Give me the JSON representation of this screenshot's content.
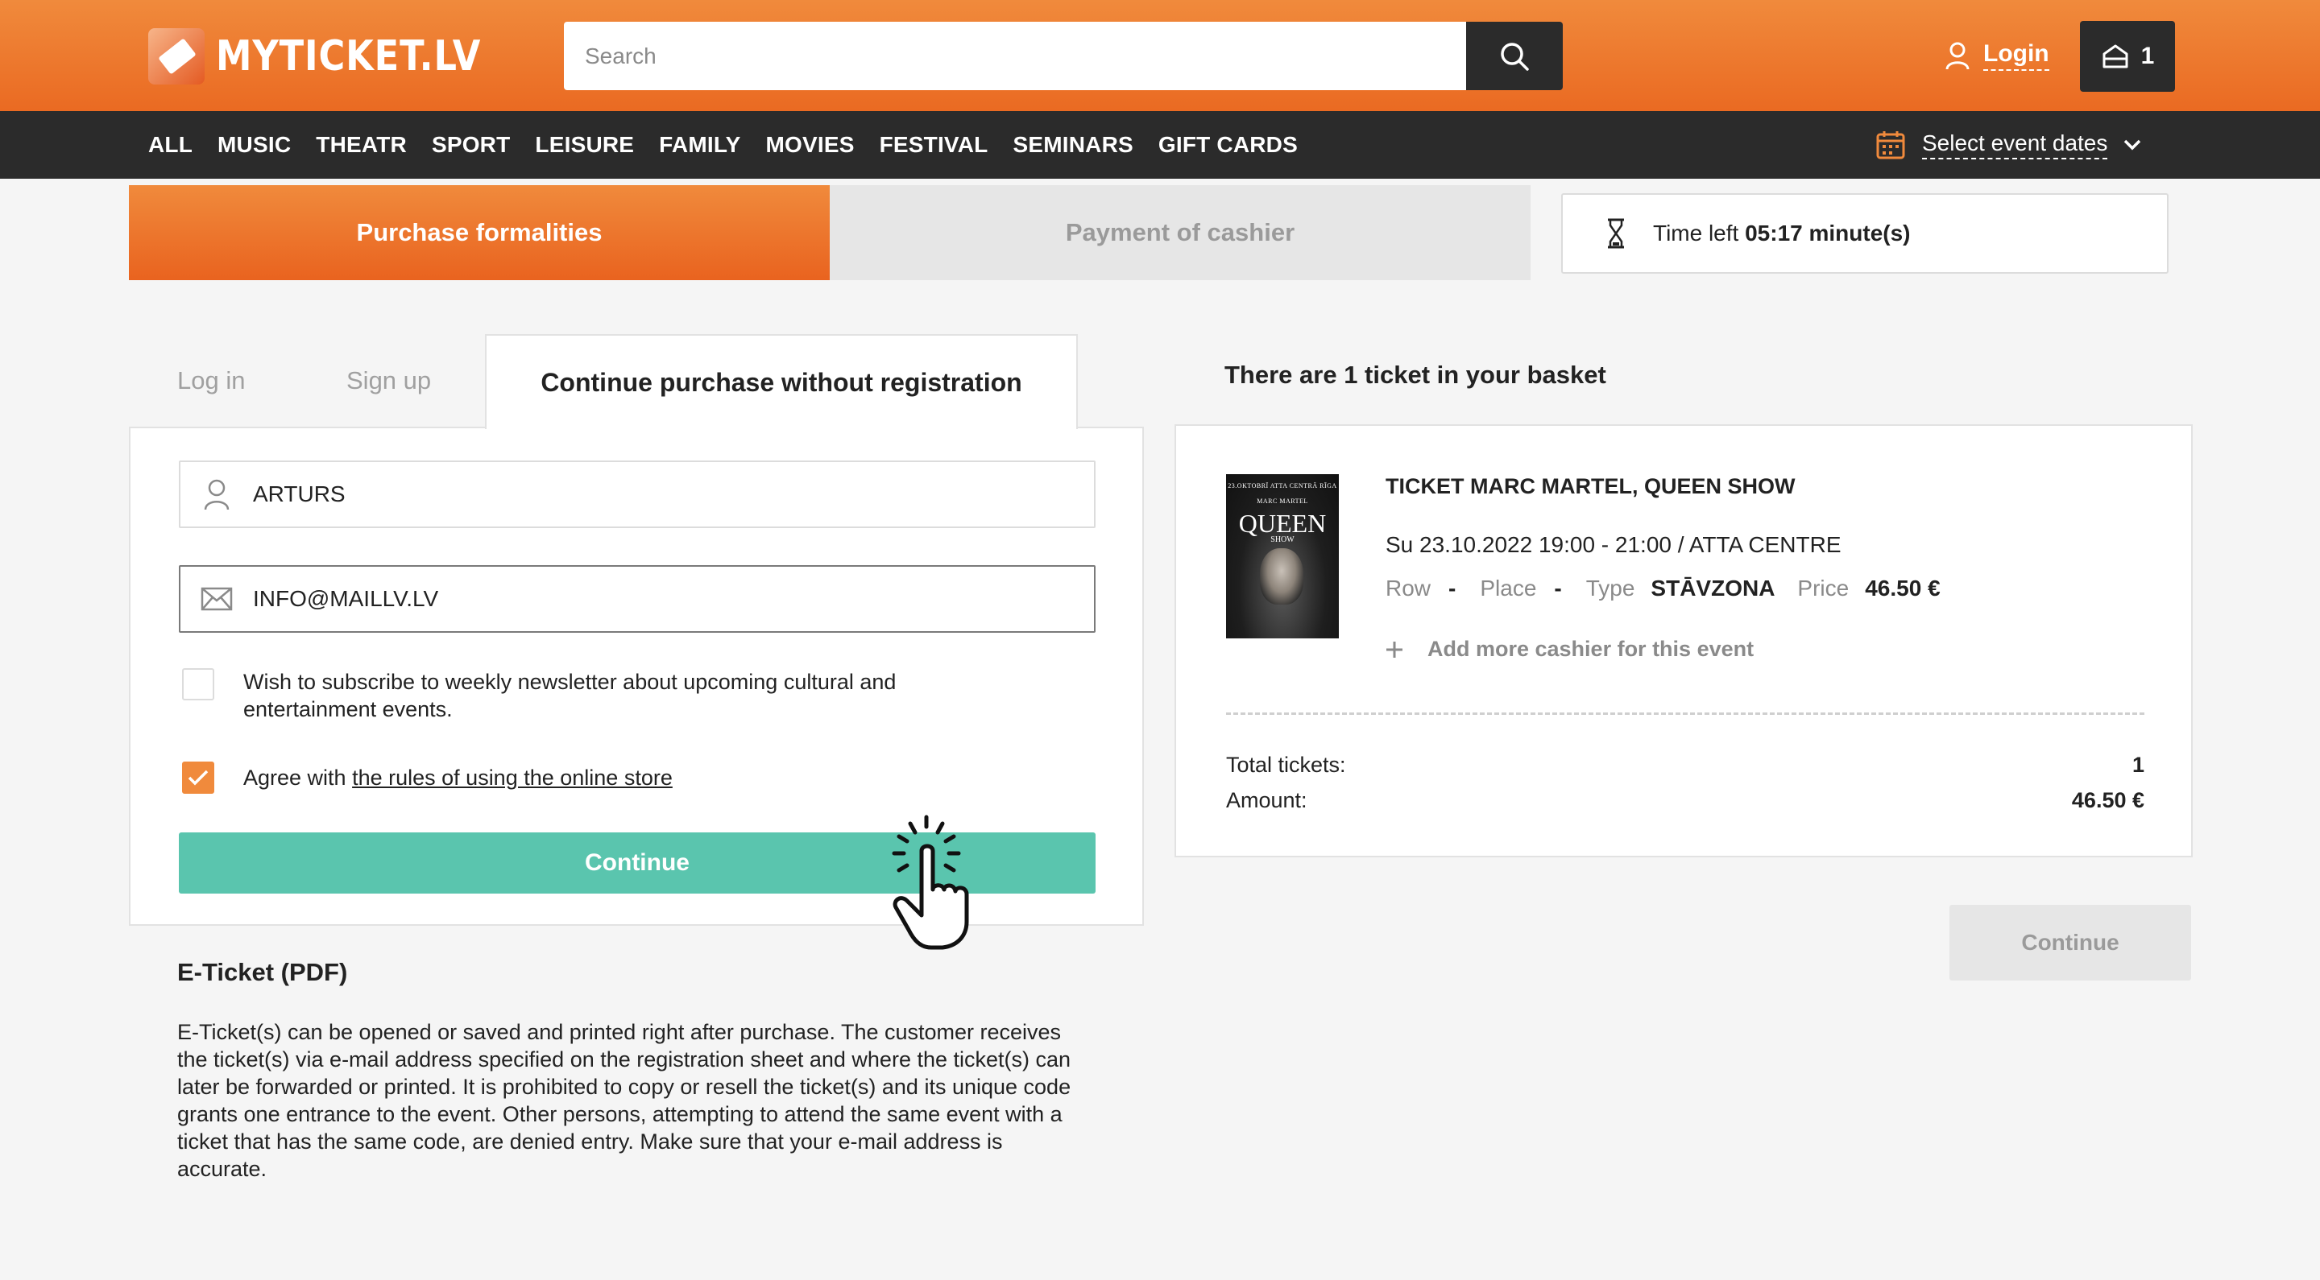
{
  "brand": {
    "name": "MYTICKET.LV"
  },
  "header": {
    "search_placeholder": "Search",
    "login_label": "Login",
    "cart_count": "1"
  },
  "nav": {
    "items": [
      "ALL",
      "MUSIC",
      "THEATR",
      "SPORT",
      "LEISURE",
      "FAMILY",
      "MOVIES",
      "FESTIVAL",
      "SEMINARS",
      "GIFT CARDS"
    ],
    "dates_label": "Select event dates"
  },
  "steps": {
    "active": "Purchase formalities",
    "inactive": "Payment of cashier"
  },
  "timer": {
    "label": "Time left",
    "value": "05:17 minute(s)"
  },
  "auth_tabs": {
    "login": "Log in",
    "signup": "Sign up",
    "guest": "Continue purchase without registration"
  },
  "form": {
    "name_value": "ARTURS",
    "email_value": "INFO@MAILLV.LV",
    "newsletter_label": "Wish to subscribe to weekly newsletter about upcoming cultural and entertainment events.",
    "newsletter_checked": false,
    "agree_prefix": "Agree with",
    "agree_link": "the rules of using the online store",
    "agree_checked": true,
    "continue_label": "Continue"
  },
  "eticket": {
    "title": "E-Ticket (PDF)",
    "text": "E-Ticket(s) can be opened or saved and printed right after purchase. The customer receives the ticket(s) via e-mail address specified on the registration sheet and where the ticket(s) can later be forwarded or printed. It is prohibited to copy or resell the ticket(s) and its unique code grants one entrance to the event. Other persons, attempting to attend the same event with a ticket that has the same code, are denied entry. Make sure that your e-mail address is accurate."
  },
  "basket": {
    "title": "There are 1 ticket in your basket",
    "poster": {
      "top": "23.OKTOBRĪ ATTA CENTRĀ RĪGA",
      "artist": "MARC MARTEL",
      "big": "QUEEN",
      "sub": "SHOW"
    },
    "event_title": "TICKET MARC MARTEL, QUEEN SHOW",
    "event_date": "Su 23.10.2022 19:00 - 21:00 / ATTA CENTRE",
    "row_label": "Row",
    "row_value": "-",
    "place_label": "Place",
    "place_value": "-",
    "type_label": "Type",
    "type_value": "STĀVZONA",
    "price_label": "Price",
    "price_value": "46.50 €",
    "add_more": "Add more cashier for this event",
    "total_tickets_label": "Total tickets:",
    "total_tickets_value": "1",
    "amount_label": "Amount:",
    "amount_value": "46.50 €",
    "continue_label": "Continue"
  },
  "colors": {
    "orange": "#f08a3c",
    "dark": "#2b2b2b",
    "green": "#5ac5ae",
    "inactive_grey": "#e6e6e6"
  }
}
